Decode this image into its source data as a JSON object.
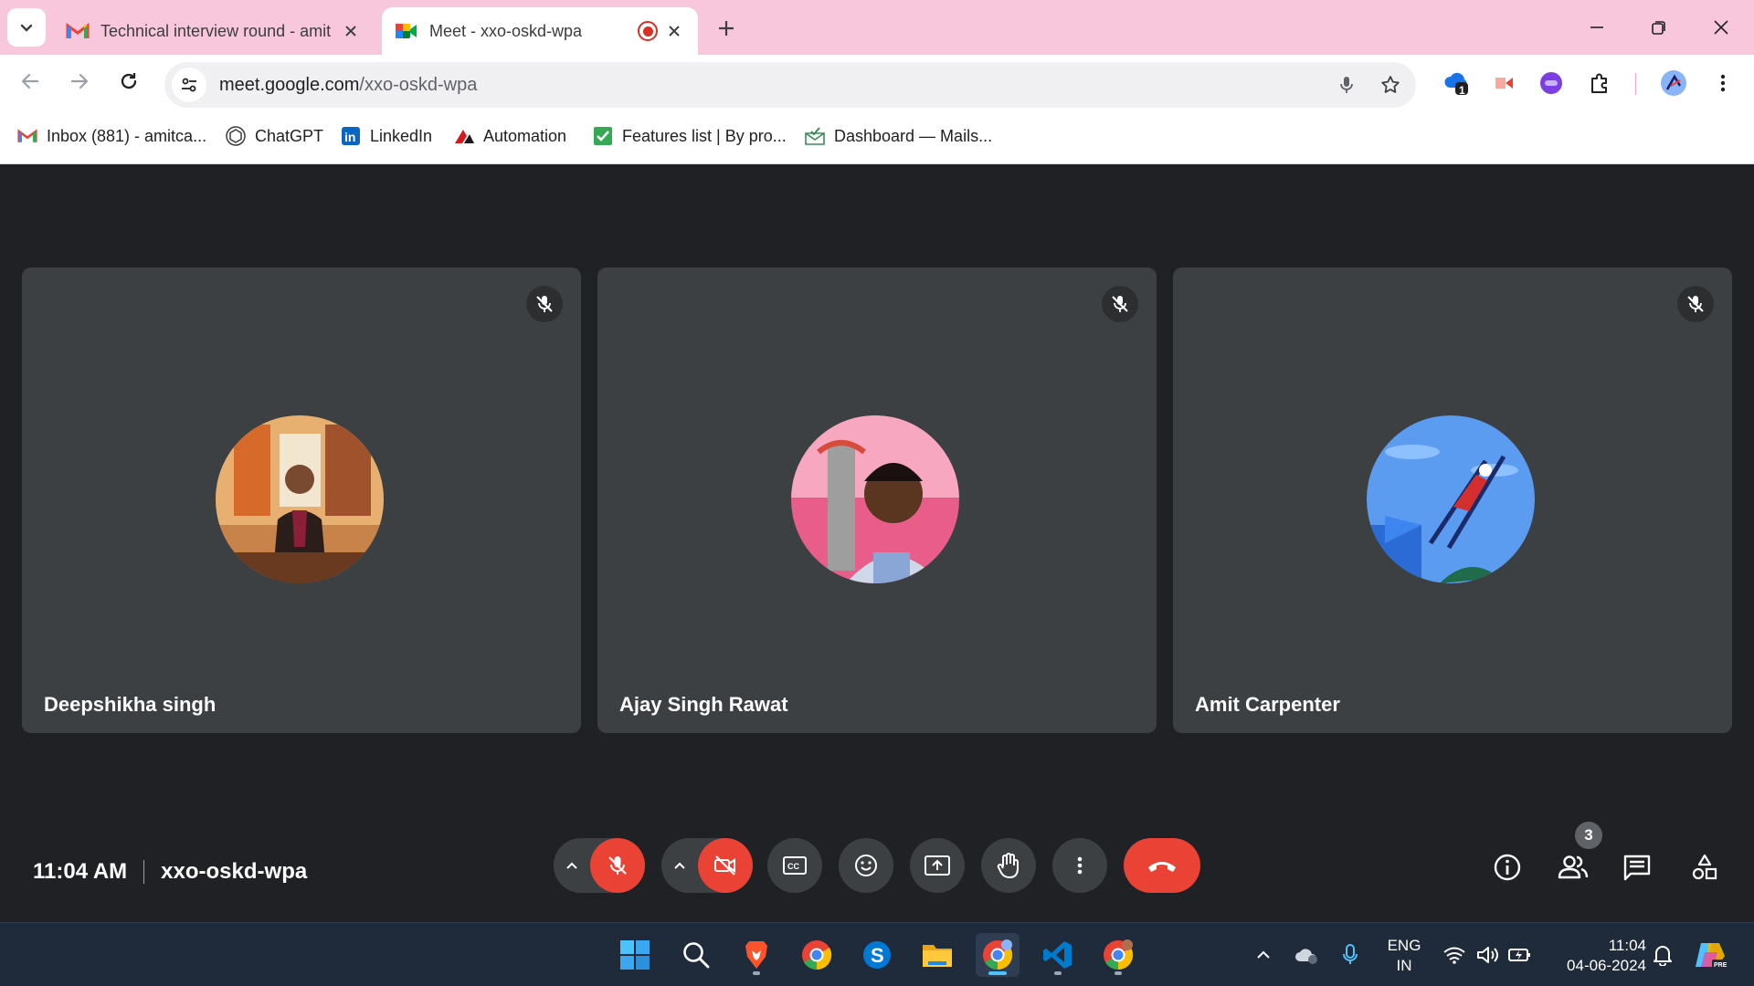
{
  "browser": {
    "tabs": [
      {
        "title": "Technical interview round - amit",
        "favicon": "gmail-icon",
        "active": false
      },
      {
        "title": "Meet - xxo-oskd-wpa",
        "favicon": "google-meet-icon",
        "active": true,
        "recording": true
      }
    ],
    "address": {
      "host": "meet.google.com",
      "path": "/xxo-oskd-wpa"
    },
    "extension_badge": "1",
    "bookmarks": [
      {
        "label": "Inbox (881) - amitca...",
        "icon": "gmail-icon"
      },
      {
        "label": "ChatGPT",
        "icon": "chatgpt-icon"
      },
      {
        "label": "LinkedIn",
        "icon": "linkedin-icon"
      },
      {
        "label": "Automation",
        "icon": "automation-icon"
      },
      {
        "label": "Features list | By pro...",
        "icon": "checkbox-icon"
      },
      {
        "label": "Dashboard — Mails...",
        "icon": "mailbox-icon"
      }
    ]
  },
  "meet": {
    "participants": [
      {
        "name": "Deepshikha singh",
        "muted": true
      },
      {
        "name": "Ajay Singh Rawat",
        "muted": true
      },
      {
        "name": "Amit Carpenter",
        "muted": true
      }
    ],
    "time": "11:04 AM",
    "meeting_code": "xxo-oskd-wpa",
    "participant_count": "3",
    "mic_on": false,
    "camera_on": false
  },
  "taskbar": {
    "apps": [
      "windows-start",
      "search",
      "brave",
      "chrome",
      "skype",
      "file-explorer",
      "chrome-profile",
      "vscode",
      "chrome-alt"
    ],
    "language": {
      "line1": "ENG",
      "line2": "IN"
    },
    "clock": {
      "time": "11:04",
      "date": "04-06-2024"
    }
  },
  "colors": {
    "tab_strip": "#f8c7dc",
    "stage_bg": "#202124",
    "tile_bg": "#3c4043",
    "danger": "#ea4335",
    "taskbar_bg": "#1f2a3a"
  }
}
